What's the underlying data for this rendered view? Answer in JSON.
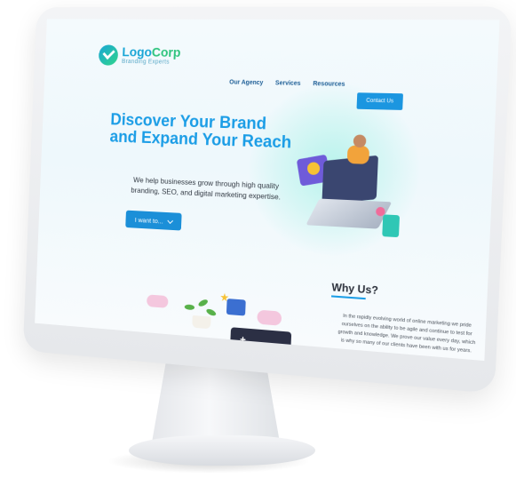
{
  "header": {
    "logo": {
      "name_part1": "Logo",
      "name_part2": "Corp",
      "tagline": "Branding Experts"
    },
    "nav": [
      "Our Agency",
      "Services",
      "Resources"
    ],
    "contact_label": "Contact Us"
  },
  "hero": {
    "title": "Discover Your Brand and Expand Your Reach",
    "subtitle": "We help businesses grow through high quality branding, SEO, and digital marketing expertise.",
    "cta_label": "I want to..."
  },
  "why": {
    "title": "Why Us?",
    "text": "In the rapidly evolving world of online marketing we pride ourselves on the ability to be agile and continue to test for growth and knowledge. We prove our value every day, which is why so many of our clients have been with us for years."
  },
  "colors": {
    "brand_blue": "#1b9de6",
    "brand_green": "#2fc47e",
    "button_blue": "#1b8fd8"
  },
  "icons": [
    "logo-check-icon",
    "chevron-down-icon"
  ]
}
